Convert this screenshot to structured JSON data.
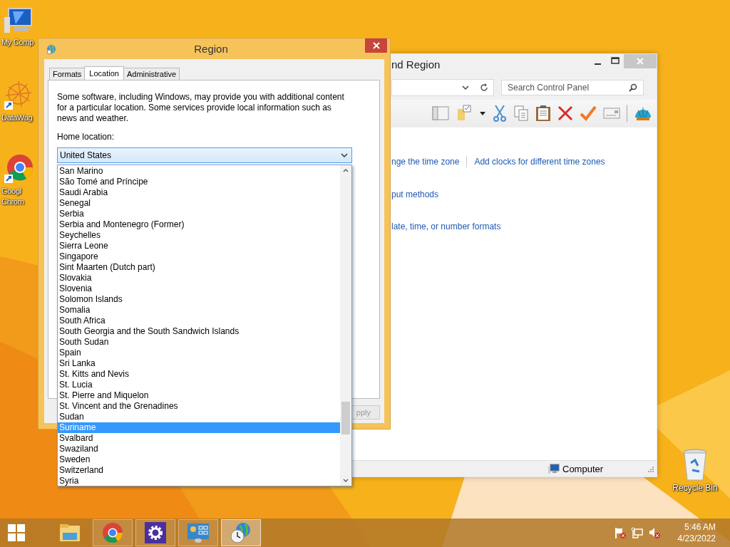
{
  "desktop_icons": [
    {
      "kind": "computer",
      "label": "My Comp"
    },
    {
      "kind": "datawag",
      "label": "DataWag"
    },
    {
      "kind": "chrome",
      "label": "Googl\nChrom"
    }
  ],
  "recycle_bin": {
    "label": "Recycle Bin"
  },
  "back_window": {
    "title": "nd Region",
    "search": {
      "placeholder": "Search Control Panel"
    },
    "link_rows": [
      {
        "links": [
          "nge the time zone",
          "Add clocks for different time zones"
        ]
      },
      {
        "links": [
          "put methods"
        ]
      },
      {
        "links": [
          "late, time, or number formats"
        ]
      }
    ],
    "status_bar": {
      "location": "Computer"
    }
  },
  "dialog": {
    "title": "Region",
    "tabs": [
      {
        "label": "Formats",
        "selected": false
      },
      {
        "label": "Location",
        "selected": true
      },
      {
        "label": "Administrative",
        "selected": false
      }
    ],
    "description": "Some software, including Windows, may provide you with additional content for a particular location. Some services provide local information such as news and weather.",
    "home_location": {
      "label": "Home location:",
      "value": "United States",
      "options": [
        {
          "label": "San Marino",
          "selected": false
        },
        {
          "label": "São Tomé and Príncipe",
          "selected": false
        },
        {
          "label": "Saudi Arabia",
          "selected": false
        },
        {
          "label": "Senegal",
          "selected": false
        },
        {
          "label": "Serbia",
          "selected": false
        },
        {
          "label": "Serbia and Montenegro (Former)",
          "selected": false
        },
        {
          "label": "Seychelles",
          "selected": false
        },
        {
          "label": "Sierra Leone",
          "selected": false
        },
        {
          "label": "Singapore",
          "selected": false
        },
        {
          "label": "Sint Maarten (Dutch part)",
          "selected": false
        },
        {
          "label": "Slovakia",
          "selected": false
        },
        {
          "label": "Slovenia",
          "selected": false
        },
        {
          "label": "Solomon Islands",
          "selected": false
        },
        {
          "label": "Somalia",
          "selected": false
        },
        {
          "label": "South Africa",
          "selected": false
        },
        {
          "label": "South Georgia and the South Sandwich Islands",
          "selected": false
        },
        {
          "label": "South Sudan",
          "selected": false
        },
        {
          "label": "Spain",
          "selected": false
        },
        {
          "label": "Sri Lanka",
          "selected": false
        },
        {
          "label": "St. Kitts and Nevis",
          "selected": false
        },
        {
          "label": "St. Lucia",
          "selected": false
        },
        {
          "label": "St. Pierre and Miquelon",
          "selected": false
        },
        {
          "label": "St. Vincent and the Grenadines",
          "selected": false
        },
        {
          "label": "Sudan",
          "selected": false
        },
        {
          "label": "Suriname",
          "selected": true
        },
        {
          "label": "Svalbard",
          "selected": false
        },
        {
          "label": "Swaziland",
          "selected": false
        },
        {
          "label": "Sweden",
          "selected": false
        },
        {
          "label": "Switzerland",
          "selected": false
        },
        {
          "label": "Syria",
          "selected": false
        }
      ]
    },
    "apply_button": {
      "label": "pply",
      "disabled": true
    }
  },
  "taskbar": {
    "apps": [
      {
        "kind": "explorer",
        "running": false,
        "selected": false
      },
      {
        "kind": "chrome",
        "running": true,
        "selected": false
      },
      {
        "kind": "settings",
        "running": true,
        "selected": false
      },
      {
        "kind": "control-panel",
        "running": true,
        "selected": false
      },
      {
        "kind": "clock-globe",
        "running": true,
        "selected": true
      }
    ]
  },
  "tray": {
    "time": "5:46 AM",
    "date": "4/23/2022"
  }
}
